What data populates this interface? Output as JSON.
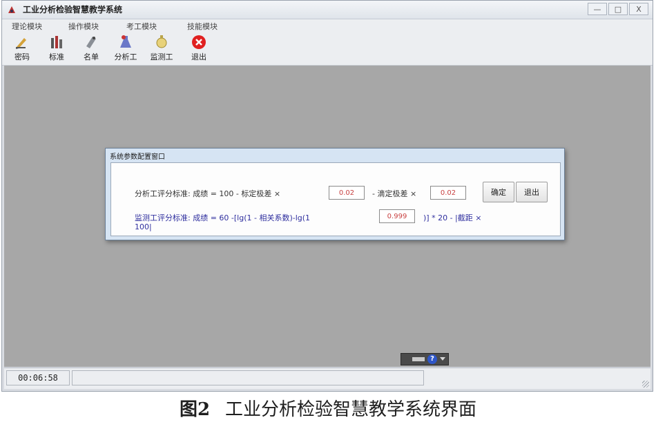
{
  "window": {
    "title": "工业分析检验智慧教学系统",
    "controls": [
      "—",
      "□",
      "X"
    ]
  },
  "menu": [
    "理论模块",
    "操作模块",
    "考工模块",
    "技能模块"
  ],
  "toolbar": [
    {
      "label": "密码",
      "icon": "pencil-icon"
    },
    {
      "label": "标准",
      "icon": "bottles-icon"
    },
    {
      "label": "名单",
      "icon": "list-icon"
    },
    {
      "label": "分析工",
      "icon": "flask-icon"
    },
    {
      "label": "监测工",
      "icon": "monitor-icon"
    },
    {
      "label": "退出",
      "icon": "close-circle-icon"
    }
  ],
  "dialog": {
    "title": "系统参数配置窗口",
    "row1_text": "分析工评分标准: 成绩 = 100 - 标定极差 ×",
    "row1_input": "0.02",
    "row1_text2": "- 滴定极差 ×",
    "row1_input2": "0.02",
    "row2_text": "监测工评分标准: 成绩 = 60 -[lg(1 - 相关系数)-lg(1",
    "row2_input": "0.999",
    "row2_text2": ")] * 20 - |截距 ×",
    "row3_text": "100|",
    "confirm_label": "确定",
    "exit_label": "退出"
  },
  "tray": {
    "help_glyph": "?"
  },
  "status": {
    "time": "00:06:58"
  },
  "caption": {
    "fig_num": "图2",
    "text": "工业分析检验智慧教学系统界面"
  },
  "colors": {
    "workspace": "#a7a7a7",
    "dialog_frame": "#d6e4f3",
    "formula_blue": "#2e2e9e",
    "input_red": "#c84040",
    "exit_red": "#e02020"
  }
}
